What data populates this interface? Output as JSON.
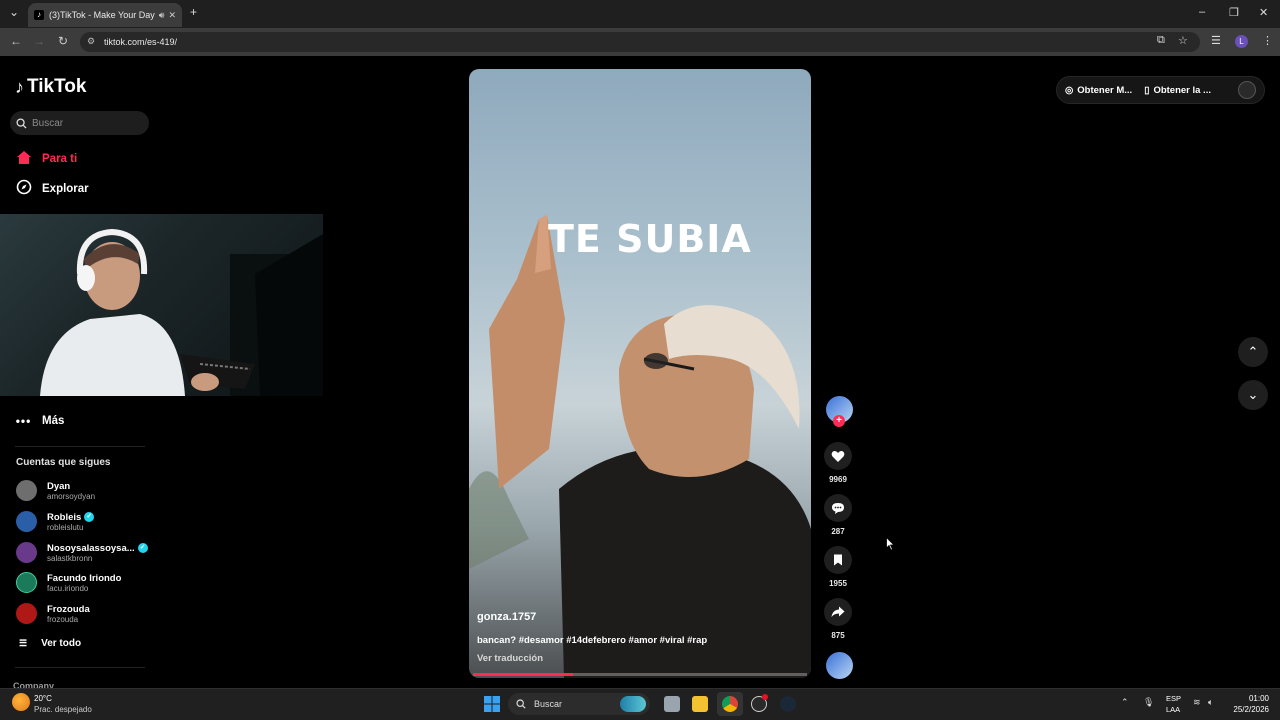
{
  "browser": {
    "tab_title": "(3)TikTok - Make Your Day",
    "url": "tiktok.com/es-419/"
  },
  "sidebar": {
    "logo_text": "TikTok",
    "search_placeholder": "Buscar",
    "nav": [
      {
        "label": "Para ti",
        "icon": "home-icon",
        "active": true
      },
      {
        "label": "Explorar",
        "icon": "compass-icon"
      },
      {
        "label": "Más",
        "icon": "more-icon"
      }
    ],
    "following_title": "Cuentas que sigues",
    "accounts": [
      {
        "name": "Dyan",
        "handle": "amorsoydyan",
        "verified": false,
        "color": "#6e6e6e"
      },
      {
        "name": "Robleis",
        "handle": "robleislutu",
        "verified": true,
        "color": "#2a5fa8"
      },
      {
        "name": "Nosoysalassoysa...",
        "handle": "salastkbronn",
        "verified": true,
        "color": "#6a3a8a"
      },
      {
        "name": "Facundo Iriondo",
        "handle": "facu.iriondo",
        "verified": false,
        "color": "#1b7a5a"
      },
      {
        "name": "Frozouda",
        "handle": "frozouda",
        "verified": false,
        "color": "#b01818"
      }
    ],
    "see_all": "Ver todo",
    "company": "Company"
  },
  "video": {
    "caption_text": "TE SUBIA",
    "username": "gonza.1757",
    "description": "bancan? #desamor #14defebrero #amor #viral #rap",
    "translate": "Ver traducción",
    "progress_fraction": 0.3
  },
  "actions": {
    "likes": "9969",
    "comments": "287",
    "saves": "1955",
    "shares": "875"
  },
  "top_right": {
    "btn1": "Obtener M...",
    "btn2": "Obtener la ..."
  },
  "taskbar": {
    "temp": "20°C",
    "weather": "Prac. despejado",
    "search": "Buscar",
    "lang1": "ESP",
    "lang2": "LAA",
    "time": "01:00",
    "date": "25/2/2026"
  },
  "colors": {
    "accent": "#fe2c55",
    "verified": "#20d5ec"
  }
}
